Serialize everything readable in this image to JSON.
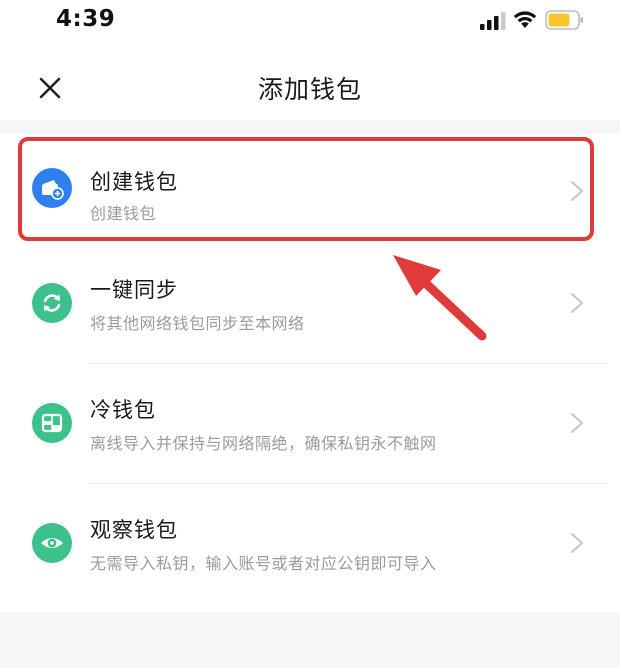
{
  "status_bar": {
    "time": "4:39"
  },
  "header": {
    "title": "添加钱包",
    "close_icon": "close-icon"
  },
  "options": [
    {
      "title": "创建钱包",
      "description": "创建钱包",
      "icon": "wallet-add-icon",
      "icon_color": "#2f7ff0"
    },
    {
      "title": "一键同步",
      "description": "将其他网络钱包同步至本网络",
      "icon": "sync-icon",
      "icon_color": "#3cc28a"
    },
    {
      "title": "冷钱包",
      "description": "离线导入并保持与网络隔绝，确保私钥永不触网",
      "icon": "cold-wallet-icon",
      "icon_color": "#3cc28a"
    },
    {
      "title": "观察钱包",
      "description": "无需导入私钥，输入账号或者对应公钥即可导入",
      "icon": "eye-icon",
      "icon_color": "#3cc28a"
    }
  ],
  "annotation": {
    "highlight_color": "#e03a3a"
  }
}
